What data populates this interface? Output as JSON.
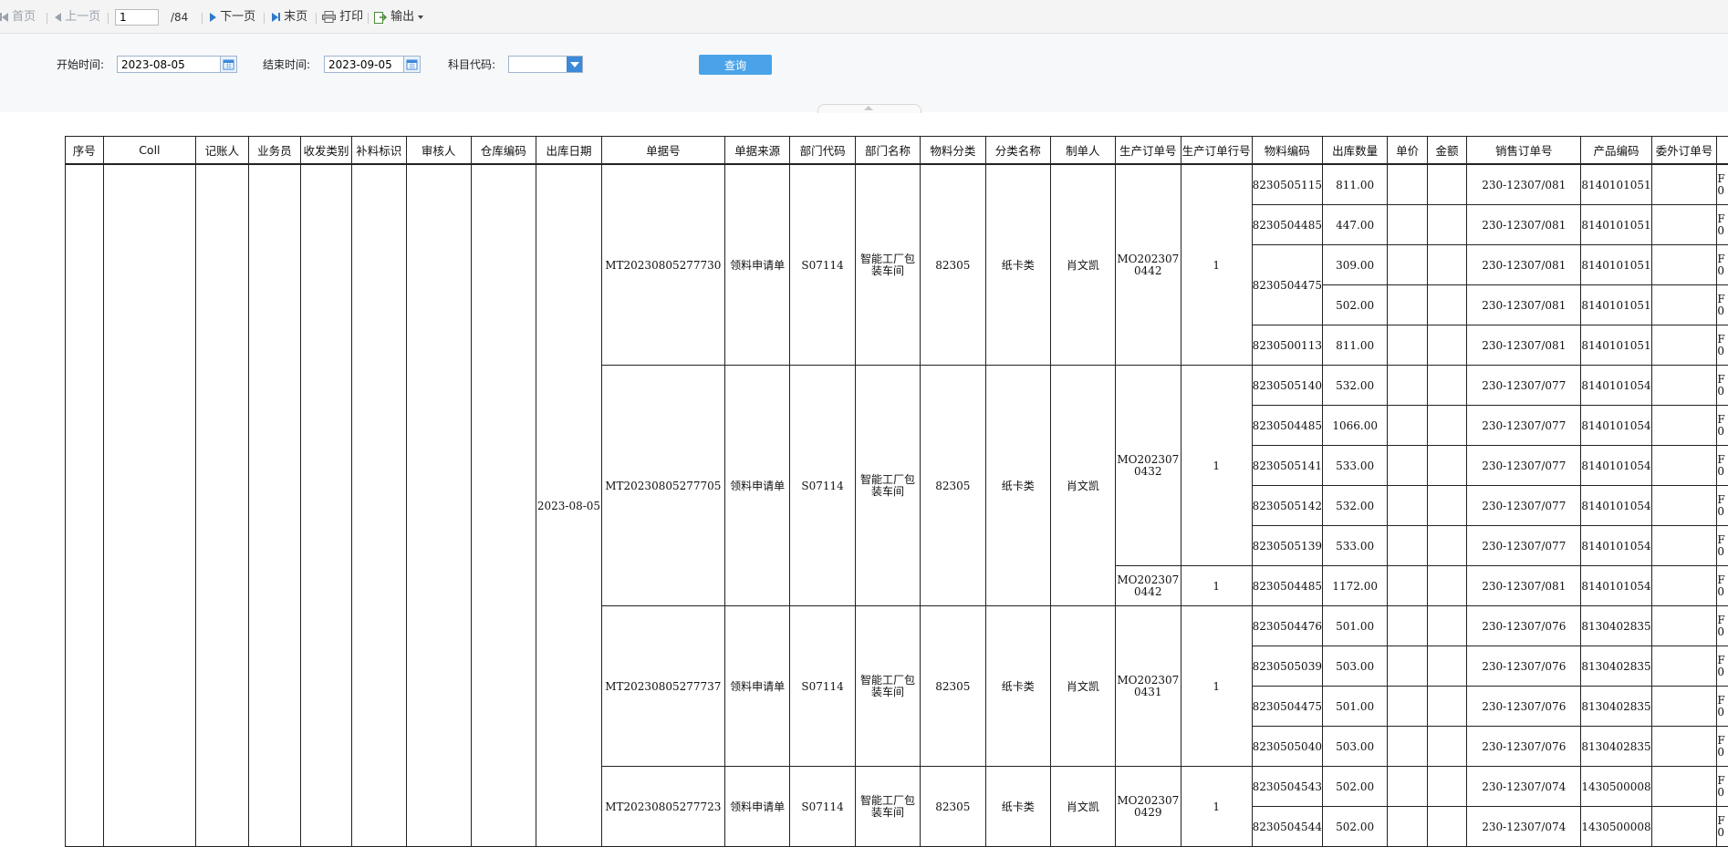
{
  "toolbar": {
    "first": "首页",
    "prev": "上一页",
    "page_value": "1",
    "total": "/84",
    "next": "下一页",
    "last": "末页",
    "print": "打印",
    "export": "输出"
  },
  "filters": {
    "start_label": "开始时间:",
    "start_value": "2023-08-05",
    "end_label": "结束时间:",
    "end_value": "2023-09-05",
    "subject_label": "科目代码:",
    "query_label": "查询"
  },
  "colors": {
    "accent": "#4aa3e8",
    "dropdown": "#3d89d9"
  },
  "table": {
    "columns": [
      "序号",
      "Coll",
      "记账人",
      "业务员",
      "收发类别",
      "补料标识",
      "审核人",
      "仓库编码",
      "出库日期",
      "单据号",
      "单据来源",
      "部门代码",
      "部门名称",
      "物料分类",
      "分类名称",
      "制单人",
      "生产订单号",
      "生产订单行号",
      "物料编码",
      "出库数量",
      "单价",
      "金额",
      "销售订单号",
      "产品编码",
      "委外订单号"
    ],
    "date": "2023-08-05",
    "groups": [
      {
        "doc": "MT20230805277730",
        "source": "领料申请单",
        "dept_code": "S07114",
        "dept_name": "智能工厂包装车间",
        "cat": "82305",
        "cat_name": "纸卡类",
        "maker": "肖文凯",
        "rows": 5,
        "orders": [
          {
            "no": "MO2023070442",
            "line": "1",
            "rows": 5
          }
        ],
        "mats": [
          {
            "code": "8230505115",
            "rows": 1
          },
          {
            "code": "8230504485",
            "rows": 1
          },
          {
            "code": "8230504475",
            "rows": 2
          },
          {
            "code": "8230500113",
            "rows": 1
          }
        ],
        "lines": [
          {
            "qty": "811.00",
            "so": "230-12307/081",
            "prod": "8140101051"
          },
          {
            "qty": "447.00",
            "so": "230-12307/081",
            "prod": "8140101051"
          },
          {
            "qty": "309.00",
            "so": "230-12307/081",
            "prod": "8140101051"
          },
          {
            "qty": "502.00",
            "so": "230-12307/081",
            "prod": "8140101051"
          },
          {
            "qty": "811.00",
            "so": "230-12307/081",
            "prod": "8140101051"
          }
        ]
      },
      {
        "doc": "MT20230805277705",
        "source": "领料申请单",
        "dept_code": "S07114",
        "dept_name": "智能工厂包装车间",
        "cat": "82305",
        "cat_name": "纸卡类",
        "maker": "肖文凯",
        "rows": 6,
        "orders": [
          {
            "no": "MO2023070432",
            "line": "1",
            "rows": 5
          },
          {
            "no": "MO2023070442",
            "line": "1",
            "rows": 1
          }
        ],
        "mats": [
          {
            "code": "8230505140",
            "rows": 1
          },
          {
            "code": "8230504485",
            "rows": 1
          },
          {
            "code": "8230505141",
            "rows": 1
          },
          {
            "code": "8230505142",
            "rows": 1
          },
          {
            "code": "8230505139",
            "rows": 1
          },
          {
            "code": "8230504485",
            "rows": 1
          }
        ],
        "lines": [
          {
            "qty": "532.00",
            "so": "230-12307/077",
            "prod": "8140101054"
          },
          {
            "qty": "1066.00",
            "so": "230-12307/077",
            "prod": "8140101054"
          },
          {
            "qty": "533.00",
            "so": "230-12307/077",
            "prod": "8140101054"
          },
          {
            "qty": "532.00",
            "so": "230-12307/077",
            "prod": "8140101054"
          },
          {
            "qty": "533.00",
            "so": "230-12307/077",
            "prod": "8140101054"
          },
          {
            "qty": "1172.00",
            "so": "230-12307/081",
            "prod": "8140101054"
          }
        ]
      },
      {
        "doc": "MT20230805277737",
        "source": "领料申请单",
        "dept_code": "S07114",
        "dept_name": "智能工厂包装车间",
        "cat": "82305",
        "cat_name": "纸卡类",
        "maker": "肖文凯",
        "rows": 4,
        "orders": [
          {
            "no": "MO2023070431",
            "line": "1",
            "rows": 4
          }
        ],
        "mats": [
          {
            "code": "8230504476",
            "rows": 1
          },
          {
            "code": "8230505039",
            "rows": 1
          },
          {
            "code": "8230504475",
            "rows": 1
          },
          {
            "code": "8230505040",
            "rows": 1
          }
        ],
        "lines": [
          {
            "qty": "501.00",
            "so": "230-12307/076",
            "prod": "8130402835"
          },
          {
            "qty": "503.00",
            "so": "230-12307/076",
            "prod": "8130402835"
          },
          {
            "qty": "501.00",
            "so": "230-12307/076",
            "prod": "8130402835"
          },
          {
            "qty": "503.00",
            "so": "230-12307/076",
            "prod": "8130402835"
          }
        ]
      },
      {
        "doc": "MT20230805277723",
        "source": "领料申请单",
        "dept_code": "S07114",
        "dept_name": "智能工厂包装车间",
        "cat": "82305",
        "cat_name": "纸卡类",
        "maker": "肖文凯",
        "rows": 2,
        "orders": [
          {
            "no": "MO2023070429",
            "line": "1",
            "rows": 2
          }
        ],
        "mats": [
          {
            "code": "8230504543",
            "rows": 1
          },
          {
            "code": "8230504544",
            "rows": 1
          }
        ],
        "lines": [
          {
            "qty": "502.00",
            "so": "230-12307/074",
            "prod": "1430500008"
          },
          {
            "qty": "502.00",
            "so": "230-12307/074",
            "prod": "1430500008"
          }
        ]
      }
    ],
    "partial_col": [
      "F",
      "0"
    ]
  }
}
